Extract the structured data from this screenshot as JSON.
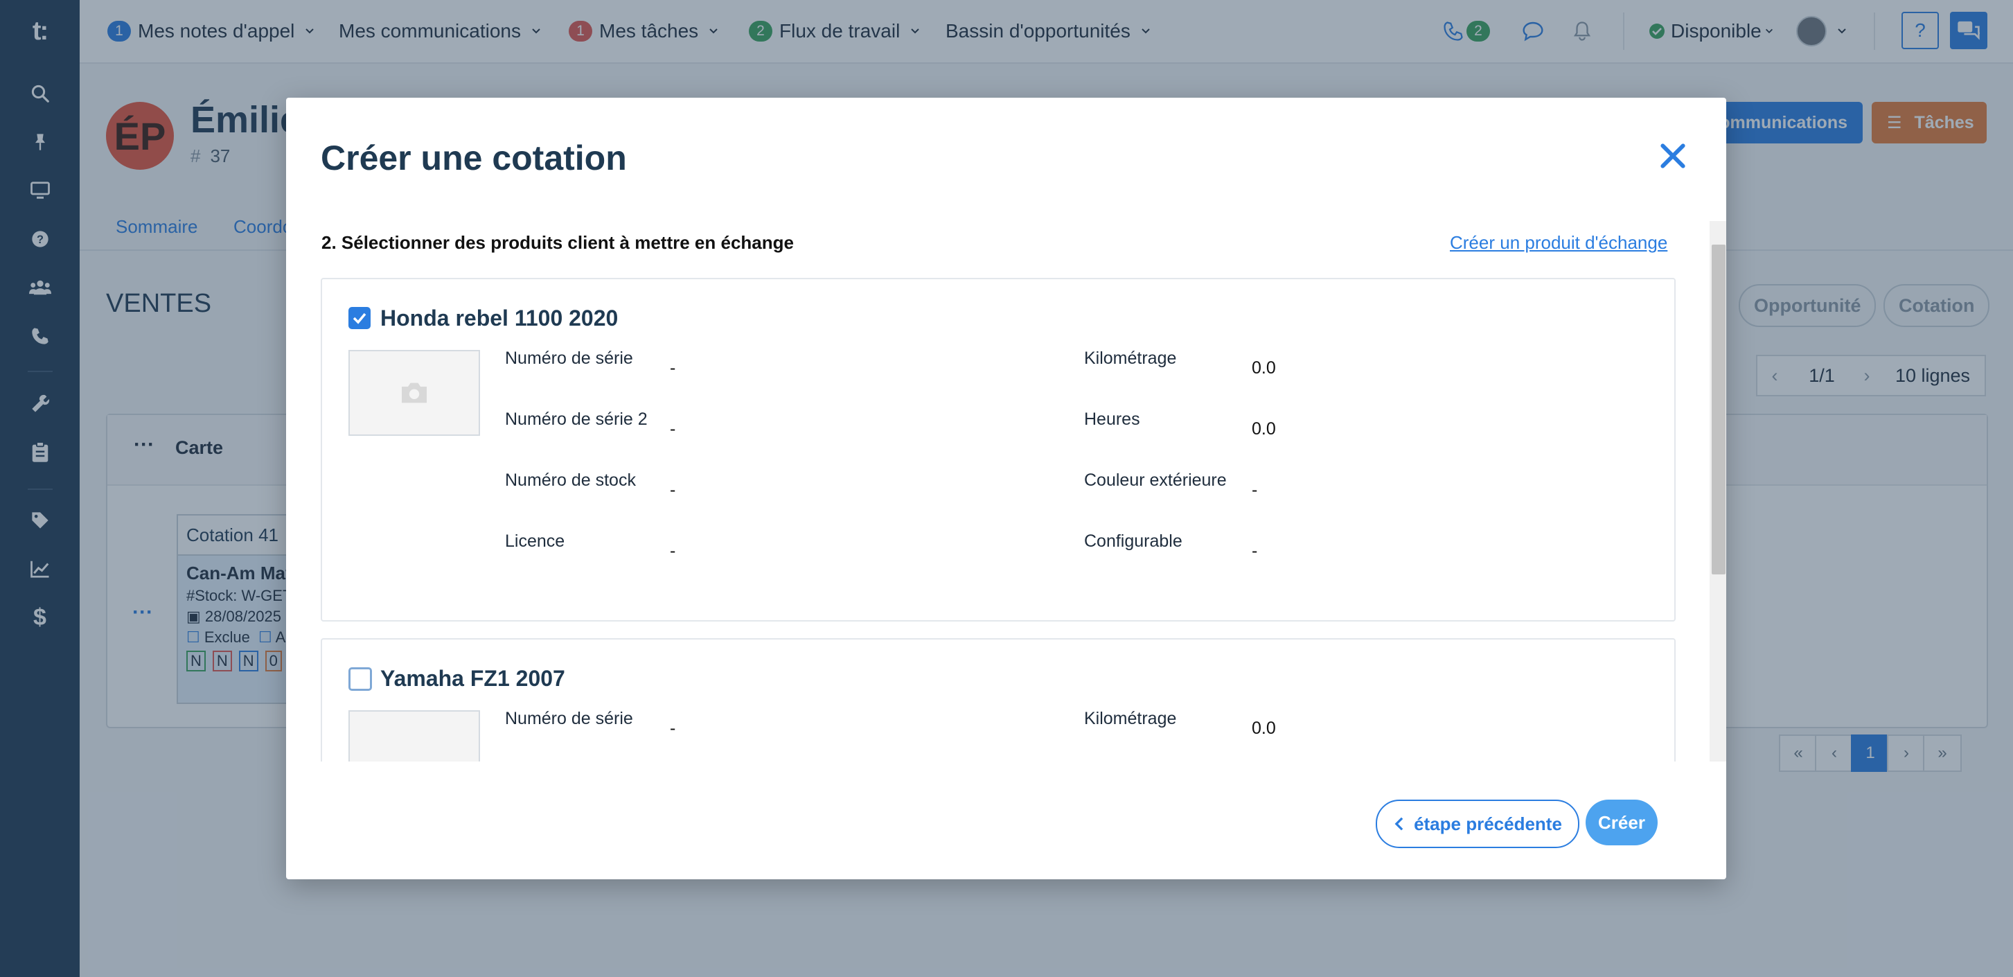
{
  "rail": {
    "logo": "t:",
    "icons": [
      "search-icon",
      "pin-icon",
      "monitor-icon",
      "help-circle-icon",
      "users-icon",
      "phone-icon",
      "wrench-icon",
      "clipboard-icon",
      "tag-icon",
      "chart-line-icon",
      "dollar-icon"
    ]
  },
  "topbar": {
    "call_notes": {
      "badge": "1",
      "label": "Mes notes d'appel"
    },
    "communications": {
      "label": "Mes communications"
    },
    "tasks": {
      "badge": "1",
      "label": "Mes tâches"
    },
    "workflow": {
      "badge": "2",
      "label": "Flux de travail"
    },
    "opportunities": {
      "label": "Bassin d'opportunités"
    },
    "phone_badge": "2",
    "status": "Disponible",
    "help": "?"
  },
  "customer": {
    "initials": "ÉP",
    "name": "Émilie",
    "number": "37",
    "btn_communications": "ommunications",
    "btn_tasks": "Tâches"
  },
  "tabs": [
    "Sommaire",
    "Coordo"
  ],
  "sales": {
    "title": "VENTES",
    "pill_opportunity": "Opportunité",
    "pill_quote": "Cotation",
    "pager_info": "1/1",
    "rows_select": "10 lignes",
    "col_card": "Carte",
    "quote_card": {
      "title": "Cotation 41",
      "vehicle": "Can-Am Mav",
      "stock": "#Stock: W-GET",
      "date": "28/08/2025",
      "excluded": "Exclue",
      "other": "A",
      "tags": [
        "N",
        "N",
        "N",
        "0"
      ]
    },
    "pagination": {
      "first": "«",
      "prev": "‹",
      "current": "1",
      "next": "›",
      "last": "»"
    }
  },
  "modal": {
    "title": "Créer une cotation",
    "step_label": "2. Sélectionner des produits client à mettre en échange",
    "create_link": "Créer un produit d'échange",
    "products": [
      {
        "checked": true,
        "name": "Honda rebel 1100 2020",
        "fields_left": [
          {
            "label": "Numéro de série",
            "value": "-"
          },
          {
            "label": "Numéro de série 2",
            "value": "-"
          },
          {
            "label": "Numéro de stock",
            "value": "-"
          },
          {
            "label": "Licence",
            "value": "-"
          }
        ],
        "fields_right": [
          {
            "label": "Kilométrage",
            "value": "0.0"
          },
          {
            "label": "Heures",
            "value": "0.0"
          },
          {
            "label": "Couleur extérieure",
            "value": "-"
          },
          {
            "label": "Configurable",
            "value": "-"
          }
        ]
      },
      {
        "checked": false,
        "name": "Yamaha FZ1 2007",
        "fields_left": [
          {
            "label": "Numéro de série",
            "value": "-"
          }
        ],
        "fields_right": [
          {
            "label": "Kilométrage",
            "value": "0.0"
          }
        ]
      }
    ],
    "btn_prev": "étape précédente",
    "btn_create": "Créer"
  }
}
